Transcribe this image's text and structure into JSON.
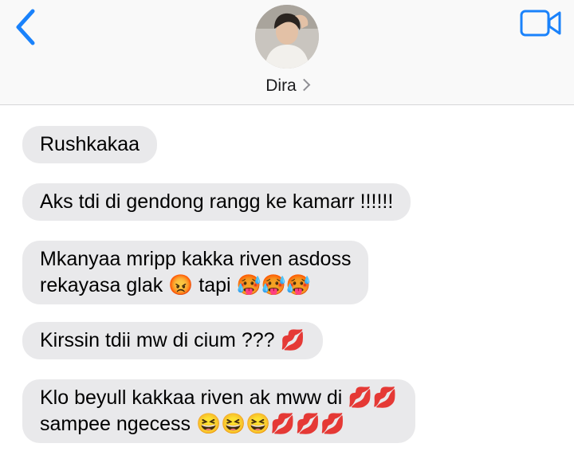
{
  "header": {
    "back_icon": "chevron-left-icon",
    "video_icon": "video-camera-icon",
    "contact_name": "Dira",
    "accent_color": "#1a82fb"
  },
  "messages": [
    {
      "line1": "Rushkakaa",
      "line2": ""
    },
    {
      "line1": "Aks tdi di gendong rangg ke kamarr !!!!!!",
      "line2": ""
    },
    {
      "line1": "Mkanyaa mripp kakka riven asdoss",
      "line2": "rekayasa glak 😡 tapi 🥵🥵🥵"
    },
    {
      "line1": "Kirssin tdii mw di cium ??? 💋",
      "line2": ""
    },
    {
      "line1": "Klo beyull kakkaa riven ak mww di 💋💋",
      "line2": "sampee ngecess 😆😆😆💋💋💋"
    }
  ]
}
